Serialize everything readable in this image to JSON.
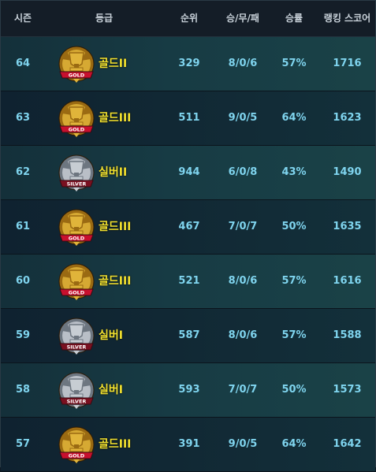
{
  "headers": {
    "season": "시즌",
    "tier": "등급",
    "rank": "순위",
    "record": "승/무/패",
    "winrate": "승률",
    "score": "랭킹 스코어"
  },
  "rows": [
    {
      "season": "64",
      "tier": "골드II",
      "badge": "gold",
      "rank": "329",
      "record": "8/0/6",
      "winrate": "57%",
      "score": "1716"
    },
    {
      "season": "63",
      "tier": "골드III",
      "badge": "gold",
      "rank": "511",
      "record": "9/0/5",
      "winrate": "64%",
      "score": "1623"
    },
    {
      "season": "62",
      "tier": "실버II",
      "badge": "silver",
      "rank": "944",
      "record": "6/0/8",
      "winrate": "43%",
      "score": "1490"
    },
    {
      "season": "61",
      "tier": "골드III",
      "badge": "gold",
      "rank": "467",
      "record": "7/0/7",
      "winrate": "50%",
      "score": "1635"
    },
    {
      "season": "60",
      "tier": "골드III",
      "badge": "gold",
      "rank": "521",
      "record": "8/0/6",
      "winrate": "57%",
      "score": "1616"
    },
    {
      "season": "59",
      "tier": "실버I",
      "badge": "silver",
      "rank": "587",
      "record": "8/0/6",
      "winrate": "57%",
      "score": "1588"
    },
    {
      "season": "58",
      "tier": "실버I",
      "badge": "silver",
      "rank": "593",
      "record": "7/0/7",
      "winrate": "50%",
      "score": "1573"
    },
    {
      "season": "57",
      "tier": "골드III",
      "badge": "gold",
      "rank": "391",
      "record": "9/0/5",
      "winrate": "64%",
      "score": "1642"
    }
  ],
  "badges": {
    "gold": {
      "label": "GOLD",
      "main": "#e0b43a",
      "dark": "#9a6a12",
      "ribbon": "#c8102e",
      "icon": "gold-tier-badge-icon"
    },
    "silver": {
      "label": "SILVER",
      "main": "#c7cdd3",
      "dark": "#6d7680",
      "ribbon": "#7a1020",
      "icon": "silver-tier-badge-icon"
    }
  },
  "colors": {
    "value_text": "#7fd4ee",
    "tier_text": "#f2e12f",
    "header_text": "#c9d2da"
  }
}
